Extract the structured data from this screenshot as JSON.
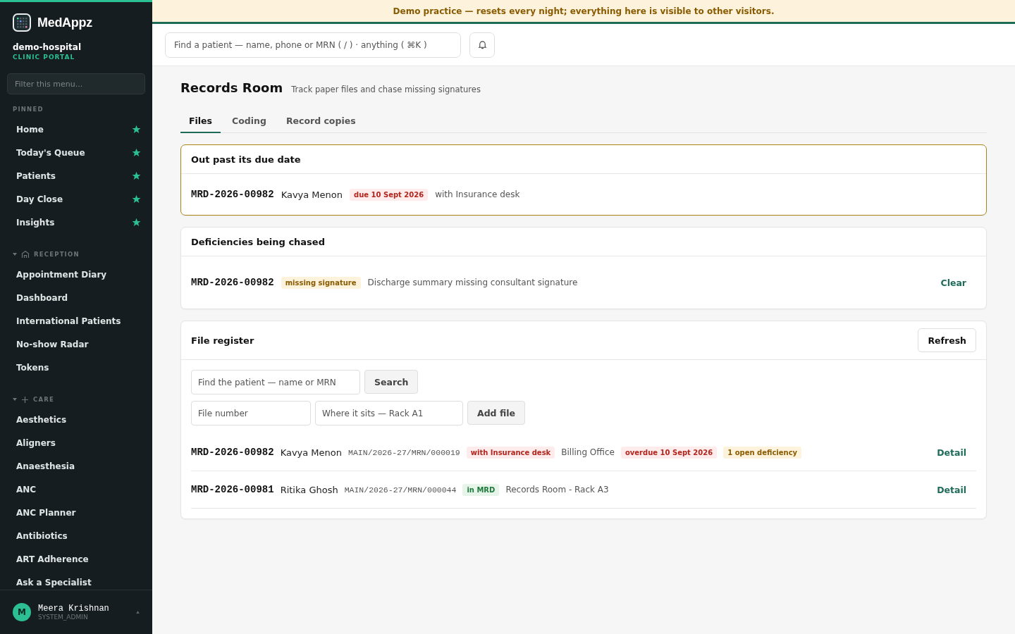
{
  "brand": {
    "name": "MedAppz",
    "org": "demo-hospital",
    "portal": "CLINIC PORTAL"
  },
  "sidebar": {
    "filter_placeholder": "Filter this menu...",
    "sections": [
      {
        "title": "PINNED",
        "kind": "plain",
        "items": [
          {
            "label": "Home",
            "pinned": true
          },
          {
            "label": "Today's Queue",
            "pinned": true
          },
          {
            "label": "Patients",
            "pinned": true
          },
          {
            "label": "Day Close",
            "pinned": true
          },
          {
            "label": "Insights",
            "pinned": true
          }
        ]
      },
      {
        "title": "RECEPTION",
        "kind": "home",
        "expanded": true,
        "items": [
          {
            "label": "Appointment Diary",
            "pinned": false
          },
          {
            "label": "Dashboard",
            "pinned": false
          },
          {
            "label": "International Patients",
            "pinned": false
          },
          {
            "label": "No-show Radar",
            "pinned": false
          },
          {
            "label": "Tokens",
            "pinned": false
          }
        ]
      },
      {
        "title": "CARE",
        "kind": "plus",
        "expanded": true,
        "items": [
          {
            "label": "Aesthetics",
            "pinned": false
          },
          {
            "label": "Aligners",
            "pinned": false
          },
          {
            "label": "Anaesthesia",
            "pinned": false
          },
          {
            "label": "ANC",
            "pinned": false
          },
          {
            "label": "ANC Planner",
            "pinned": false
          },
          {
            "label": "Antibiotics",
            "pinned": false
          },
          {
            "label": "ART Adherence",
            "pinned": false
          },
          {
            "label": "Ask a Specialist",
            "pinned": false
          }
        ]
      }
    ],
    "user": {
      "initial": "M",
      "name": "Meera Krishnan",
      "role": "SYSTEM_ADMIN"
    }
  },
  "banner": "Demo practice — resets every night; everything here is visible to other visitors.",
  "search": {
    "placeholder": "Find a patient — name, phone or MRN ( / ) · anything ( ⌘K )"
  },
  "page": {
    "title": "Records Room",
    "subtitle": "Track paper files and chase missing signatures"
  },
  "tabs": [
    {
      "label": "Files",
      "selected": true
    },
    {
      "label": "Coding",
      "selected": false
    },
    {
      "label": "Record copies",
      "selected": false
    }
  ],
  "overdue": {
    "title": "Out past its due date",
    "rows": [
      {
        "mrn": "MRD-2026-00982",
        "name": "Kavya Menon",
        "tag": {
          "text": "due 10 Sept 2026",
          "kind": "danger"
        },
        "note": "with Insurance desk"
      }
    ]
  },
  "deficiencies": {
    "title": "Deficiencies being chased",
    "rows": [
      {
        "mrn": "MRD-2026-00982",
        "tag": {
          "text": "missing signature",
          "kind": "warning"
        },
        "note": "Discharge summary missing consultant signature",
        "action": "Clear"
      }
    ]
  },
  "register": {
    "title": "File register",
    "refresh": "Refresh",
    "find_placeholder": "Find the patient — name or MRN",
    "search_button": "Search",
    "file_placeholder": "File number",
    "location_placeholder": "Where it sits — Rack A1",
    "add_button": "Add file",
    "rows": [
      {
        "mrn": "MRD-2026-00982",
        "name": "Kavya Menon",
        "file": "MAIN/2026-27/MRN/000019",
        "parts": [
          {
            "kind": "danger",
            "text": "with Insurance desk"
          },
          {
            "kind": "text",
            "text": "Billing Office"
          },
          {
            "kind": "danger",
            "text": "overdue 10 Sept 2026"
          },
          {
            "kind": "warning",
            "text": "1 open deficiency"
          }
        ],
        "action": "Detail"
      },
      {
        "mrn": "MRD-2026-00981",
        "name": "Ritika Ghosh",
        "file": "MAIN/2026-27/MRN/000044",
        "parts": [
          {
            "kind": "success",
            "text": "in MRD"
          },
          {
            "kind": "text",
            "text": "Records Room - Rack A3"
          }
        ],
        "action": "Detail"
      }
    ]
  }
}
